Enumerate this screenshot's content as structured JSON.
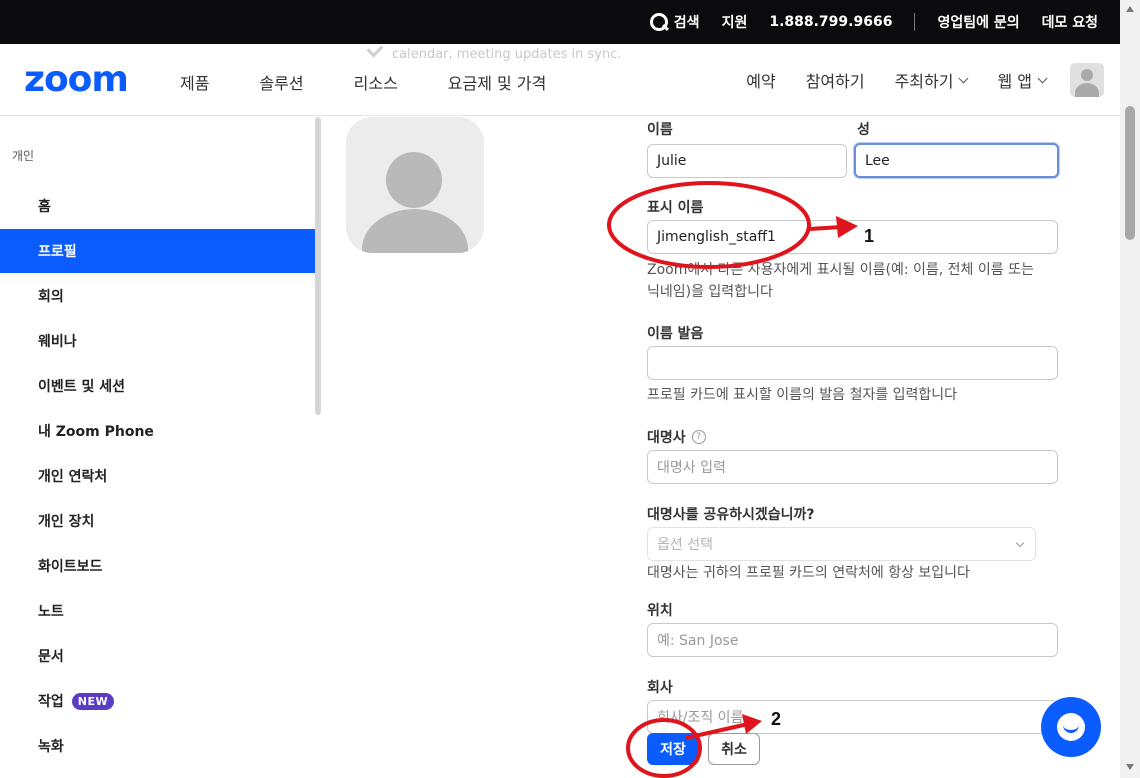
{
  "utility_bar": {
    "search": "검색",
    "support": "지원",
    "phone": "1.888.799.9666",
    "contact_sales": "영업팀에 문의",
    "demo": "데모 요청"
  },
  "nav": {
    "logo": "zoom",
    "ghost_text": "calendar, meeting updates in sync.",
    "left": [
      "제품",
      "솔루션",
      "리소스",
      "요금제 및 가격"
    ],
    "schedule": "예약",
    "join": "참여하기",
    "host": "주최하기",
    "web_app": "웹 앱"
  },
  "sidebar": {
    "heading": "개인",
    "items": [
      {
        "label": "홈"
      },
      {
        "label": "프로필",
        "active": true
      },
      {
        "label": "회의"
      },
      {
        "label": "웨비나"
      },
      {
        "label": "이벤트 및 세션"
      },
      {
        "label": "내 Zoom Phone"
      },
      {
        "label": "개인 연락처"
      },
      {
        "label": "개인 장치"
      },
      {
        "label": "화이트보드"
      },
      {
        "label": "노트"
      },
      {
        "label": "문서"
      },
      {
        "label": "작업",
        "badge": "NEW"
      },
      {
        "label": "녹화"
      }
    ]
  },
  "form": {
    "first_name_label": "이름",
    "first_name_value": "Julie",
    "last_name_label": "성",
    "last_name_value": "Lee",
    "display_name_label": "표시 이름",
    "display_name_value": "Jimenglish_staff1",
    "display_name_help_line1": "Zoom에서 다른 사용자에게 표시될 이름(예: 이름, 전체 이름 또는",
    "display_name_help_line2": "닉네임)을 입력합니다",
    "pronunciation_label": "이름 발음",
    "pronunciation_value": "",
    "pronunciation_help": "프로필 카드에 표시할 이름의 발음 철자를 입력합니다",
    "pronouns_label": "대명사",
    "pronouns_help_icon": "?",
    "pronouns_placeholder": "대명사 입력",
    "share_pronouns_label": "대명사를 공유하시겠습니까?",
    "share_pronouns_placeholder": "옵션 선택",
    "share_pronouns_help": "대명사는 귀하의 프로필 카드의 연락처에 항상 보입니다",
    "location_label": "위치",
    "location_placeholder": "예: San Jose",
    "company_label": "회사",
    "company_placeholder": "회사/조직 이름",
    "save": "저장",
    "cancel": "취소"
  },
  "annotations": {
    "step1": "1",
    "step2": "2",
    "color": "#e0141c"
  },
  "colors": {
    "brand": "#0b5cff",
    "top_bar": "#0b0b0d",
    "badge": "#5b3cc4"
  }
}
